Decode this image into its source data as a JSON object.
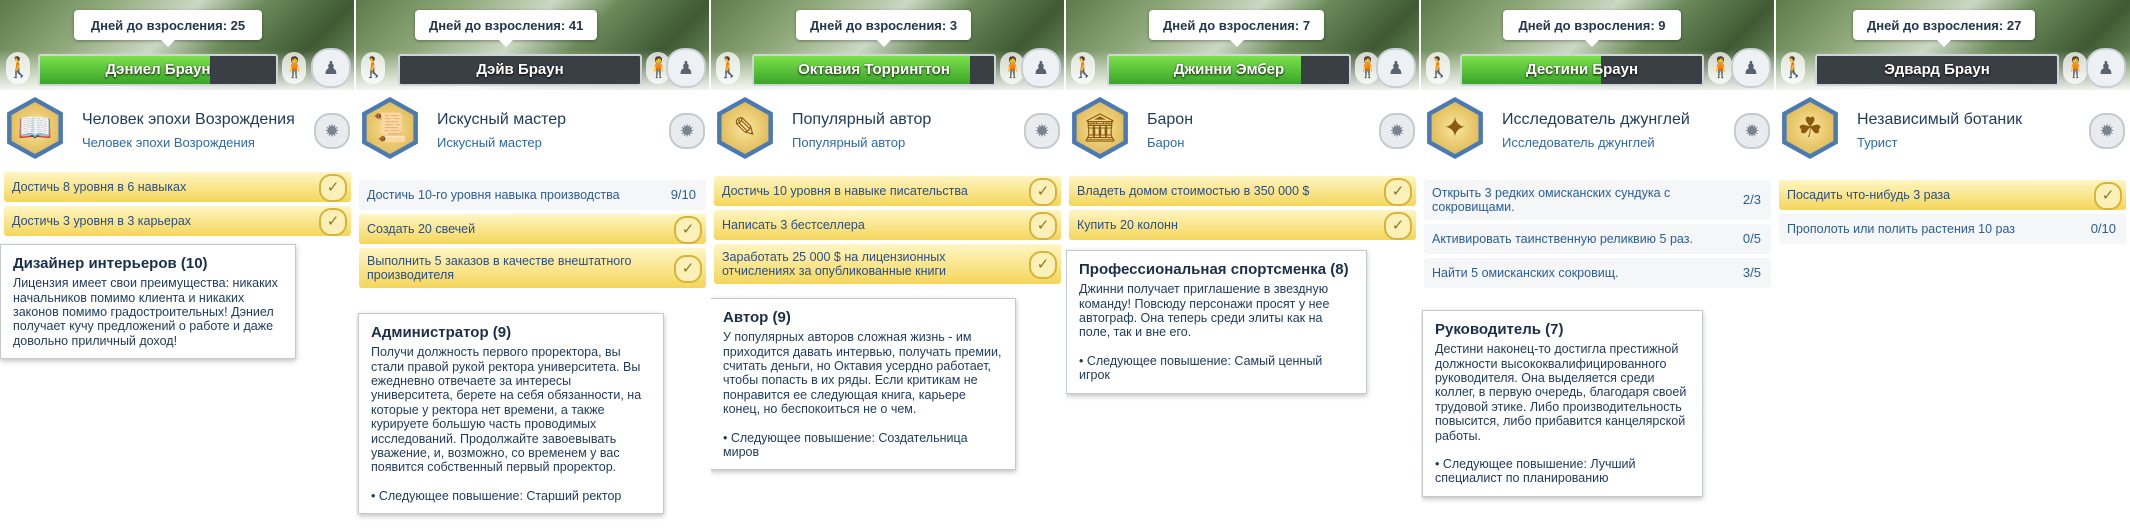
{
  "panels": [
    {
      "days_label": "Дней до взросления: 25",
      "name": "Дэниел Браун",
      "need_level": 0.72,
      "aspiration_icon": "renaissance-book-icon",
      "aspiration_title": "Человек эпохи Возрождения",
      "aspiration_subtitle": "Человек эпохи Возрождения",
      "tasks": [
        {
          "label": "Достичь 8 уровня в 6 навыках",
          "progress": "",
          "done": true
        },
        {
          "label": "Достичь 3 уровня в 3 карьерах",
          "progress": "",
          "done": true
        }
      ],
      "card_title": "Дизайнер интерьеров (10)",
      "card_body": "Лицензия имеет свои преимущества: никаких начальников помимо клиента и никаких законов помимо градостроительных! Дэниел получает кучу предложений о работе и даже довольно приличный доход!",
      "card_next": ""
    },
    {
      "days_label": "Дней до взросления: 41",
      "name": "Дэйв Браун",
      "need_level": 0.0,
      "aspiration_icon": "scroll-icon",
      "aspiration_title": "Искусный мастер",
      "aspiration_subtitle": "Искусный мастер",
      "tasks": [
        {
          "label": "Достичь 10-го уровня навыка производства",
          "progress": "9/10",
          "done": false
        },
        {
          "label": "Создать 20 свечей",
          "progress": "",
          "done": true
        },
        {
          "label": "Выполнить 5 заказов в качестве внештатного производителя",
          "progress": "",
          "done": true
        }
      ],
      "card_title": "Администратор (9)",
      "card_body": "Получи должность первого проректора, вы стали правой рукой ректора университета. Вы ежедневно отвечаете за интересы университета, берете на себя обязанности, на которые у ректора нет времени, а также курируете большую часть проводимых исследований. Продолжайте завоевывать уважение, и, возможно, со временем у вас появится собственный первый проректор.",
      "card_next": "• Следующее повышение: Старший ректор"
    },
    {
      "days_label": "Дней до взросления: 3",
      "name": "Октавия Торрингтон",
      "need_level": 0.9,
      "aspiration_icon": "notebook-pen-icon",
      "aspiration_title": "Популярный автор",
      "aspiration_subtitle": "Популярный автор",
      "tasks": [
        {
          "label": "Достичь 10 уровня в навыке писательства",
          "progress": "",
          "done": true
        },
        {
          "label": "Написать 3 бестселлера",
          "progress": "",
          "done": true
        },
        {
          "label": "Заработать 25 000 $ на лицензионных отчислениях за опубликованные книги",
          "progress": "",
          "done": true
        }
      ],
      "card_title": "Автор (9)",
      "card_body": "У популярных авторов сложная жизнь - им приходится давать интервью, получать премии, считать деньги, но Октавия усердно работает, чтобы попасть в их ряды. Если критикам не понравится ее следующая книга, карьере конец, но беспокоиться не о чем.",
      "card_next": "• Следующее повышение: Создательница миров"
    },
    {
      "days_label": "Дней до взросления: 7",
      "name": "Джинни Эмбер",
      "need_level": 0.8,
      "aspiration_icon": "mansion-icon",
      "aspiration_title": "Барон",
      "aspiration_subtitle": "Барон",
      "tasks": [
        {
          "label": "Владеть домом стоимостью в 350 000 $",
          "progress": "",
          "done": true
        },
        {
          "label": "Купить 20 колонн",
          "progress": "",
          "done": true
        }
      ],
      "card_title": "Профессиональная спортсменка (8)",
      "card_body": "Джинни получает приглашение в звездную команду! Повсюду персонажи просят у нее автограф. Она теперь среди элиты как на поле, так и вне его.",
      "card_next": "• Следующее повышение: Самый ценный игрок"
    },
    {
      "days_label": "Дней до взросления: 9",
      "name": "Дестини Браун",
      "need_level": 0.58,
      "aspiration_icon": "treasure-idol-icon",
      "aspiration_title": "Исследователь джунглей",
      "aspiration_subtitle": "Исследователь джунглей",
      "tasks": [
        {
          "label": "Открыть 3 редких омисканских сундука с сокровищами.",
          "progress": "2/3",
          "done": false
        },
        {
          "label": "Активировать таинственную реликвию 5 раз.",
          "progress": "0/5",
          "done": false
        },
        {
          "label": "Найти 5 омисканских сокровищ.",
          "progress": "3/5",
          "done": false
        }
      ],
      "card_title": "Руководитель (7)",
      "card_body": "Дестини наконец-то достигла престижной должности высококвалифицированного руководителя. Она выделяется среди коллег, в первую очередь, благодаря своей трудовой этике. Либо производительность повысится, либо прибавится канцелярской работы.",
      "card_next": "• Следующее повышение: Лучший специалист по планированию"
    },
    {
      "days_label": "Дней до взросления: 27",
      "name": "Эдвард Браун",
      "need_level": 0.0,
      "aspiration_icon": "sprout-icon",
      "aspiration_title": "Независимый ботаник",
      "aspiration_subtitle": "Турист",
      "tasks": [
        {
          "label": "Посадить что-нибудь 3 раза",
          "progress": "",
          "done": true
        },
        {
          "label": "Прополоть или полить растения 10 раз",
          "progress": "0/10",
          "done": false
        }
      ],
      "card_title": "",
      "card_body": "",
      "card_next": ""
    }
  ],
  "icons": {
    "figure_left": "child-figure-icon",
    "figure_right": "adult-figure-icon",
    "group": "household-icon",
    "aspiration_menu": "star-badge-icon",
    "check": "checkmark-icon"
  },
  "colors": {
    "need_fill": "#4fc23a",
    "done_task": "#f4d65a",
    "text_blue": "#2a5d9a"
  }
}
